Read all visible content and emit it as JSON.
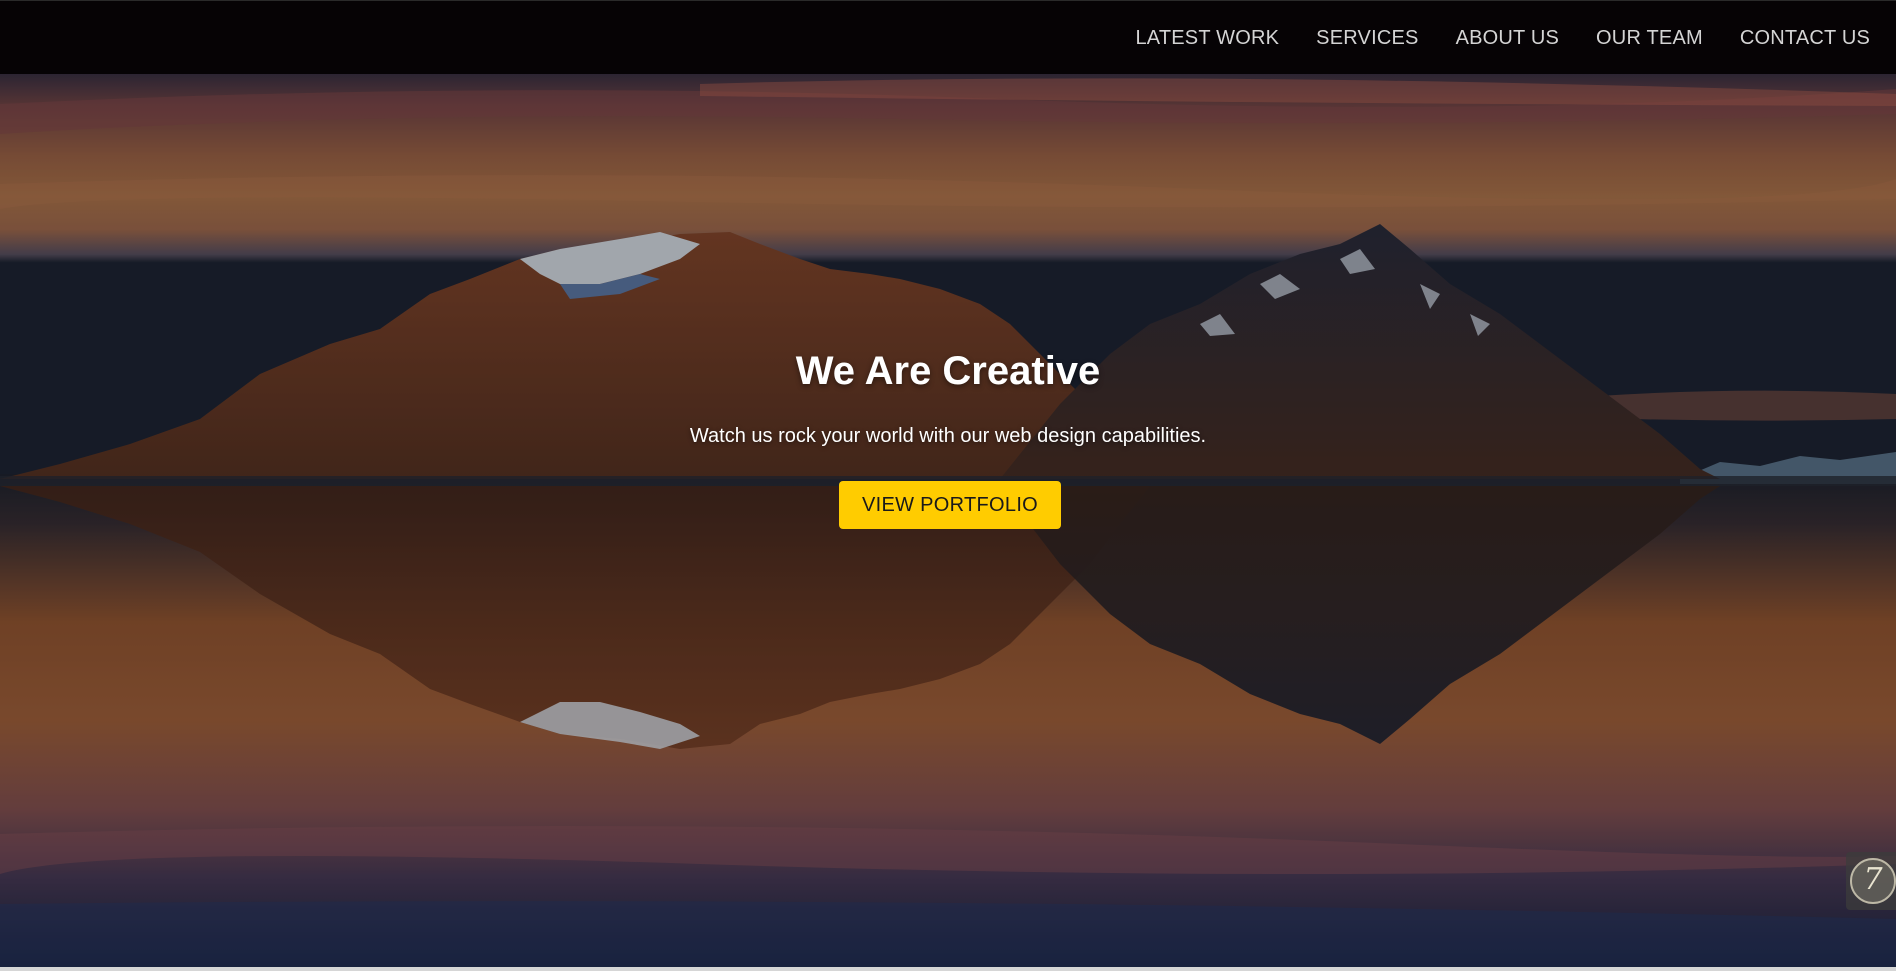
{
  "nav": {
    "items": [
      {
        "label": "LATEST WORK"
      },
      {
        "label": "SERVICES"
      },
      {
        "label": "ABOUT US"
      },
      {
        "label": "OUR TEAM"
      },
      {
        "label": "CONTACT US"
      }
    ]
  },
  "hero": {
    "title": "We Are Creative",
    "subtitle": "Watch us rock your world with our web design capabilities.",
    "button_label": "VIEW PORTFOLIO",
    "background": "mountain-lake-reflection-sunset"
  },
  "widget": {
    "icon": "assistant-icon",
    "glyph": "7"
  },
  "colors": {
    "navbar_bg": "#060305",
    "nav_text": "#d4d4d4",
    "button_bg": "#ffcc00",
    "button_text": "#1a1a1a",
    "hero_text": "#ffffff"
  }
}
